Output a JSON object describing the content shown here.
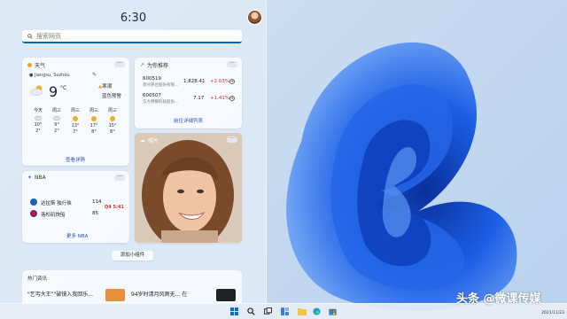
{
  "panel": {
    "time": "6:30",
    "search_placeholder": "搜索网页"
  },
  "weather": {
    "title": "天气",
    "location": "Jiangsu, Suzhou",
    "temp": "9",
    "unit": "°C",
    "condition": "寒潮",
    "alert": "蓝色预警",
    "days": [
      {
        "day": "今天",
        "hi": "10°",
        "lo": "2°"
      },
      {
        "day": "周三",
        "hi": "9°",
        "lo": "2°"
      },
      {
        "day": "周三",
        "hi": "13°",
        "lo": "7°"
      },
      {
        "day": "周三",
        "hi": "17°",
        "lo": "8°"
      },
      {
        "day": "周三",
        "hi": "15°",
        "lo": "8°"
      }
    ],
    "details_link": "查看详情"
  },
  "stocks": {
    "title": "为你推荐",
    "items": [
      {
        "code": "600519",
        "name": "贵州茅台股份有限...",
        "price": "1,828.41",
        "change": "+2.03%"
      },
      {
        "code": "600507",
        "name": "方大特钢科技股份...",
        "price": "7.17",
        "change": "+1.41%"
      }
    ],
    "details_link": "前往详细列表"
  },
  "photos": {
    "title": "照片"
  },
  "nba": {
    "title": "NBA",
    "teams": [
      {
        "name": "达拉斯 独行侠",
        "score": "114"
      },
      {
        "name": "洛杉矶快船",
        "score": "85"
      }
    ],
    "status": "Q4 5:41",
    "more_link": "更多 NBA"
  },
  "add_widget": "添加小组件",
  "news": {
    "title": "热门资讯",
    "headline": "\"乞丐大王\"\"破镜入我回乐...  ",
    "headline2": "94岁时清月风雨无... 在"
  },
  "watermark": "头条 @微课传媒",
  "date": "2021/11/23",
  "colors": {
    "accent": "#0067c0",
    "up": "#d0312d",
    "bloom": "#1a4fd6"
  }
}
